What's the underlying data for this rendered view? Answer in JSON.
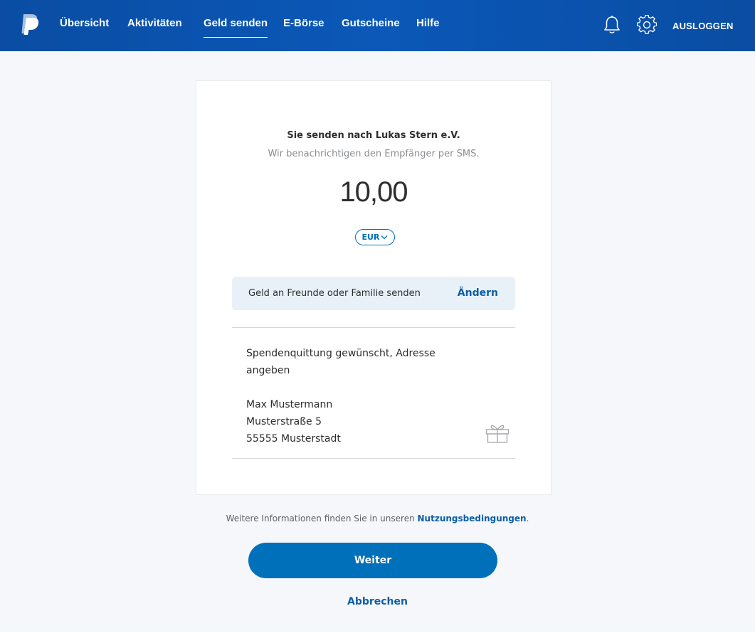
{
  "header": {
    "nav": [
      {
        "label": "Übersicht"
      },
      {
        "label": "Aktivitäten"
      },
      {
        "label": "Geld senden"
      },
      {
        "label": "E-Börse"
      },
      {
        "label": "Gutscheine"
      },
      {
        "label": "Hilfe"
      }
    ],
    "active_tab": "Geld senden",
    "logout_label": "AUSLOGGEN",
    "icons": [
      "paypal-logo",
      "bell-icon",
      "gear-icon"
    ]
  },
  "payment": {
    "recipient_line": "Sie senden nach Lukas Stern e.V.",
    "notice": "Wir benachrichtigen den Empfänger per SMS.",
    "amount": "10,00",
    "currency": "EUR",
    "type_label": "Geld an Freunde oder Familie senden",
    "change_label": "Ändern",
    "note": "Spendenquittung gewünscht, Adresse angeben\n\nMax Mustermann\nMusterstraße 5\n55555 Musterstadt"
  },
  "footer": {
    "terms_prefix": "Weitere Informationen finden Sie in unseren",
    "terms_link": "Nutzungsbedingungen",
    "terms_suffix": ".",
    "continue_label": "Weiter",
    "cancel_label": "Abbrechen"
  },
  "colors": {
    "header_bg": "#0b52ae",
    "primary": "#0070ba",
    "link": "#0b5ea8",
    "page_bg": "#f5f7fa"
  }
}
